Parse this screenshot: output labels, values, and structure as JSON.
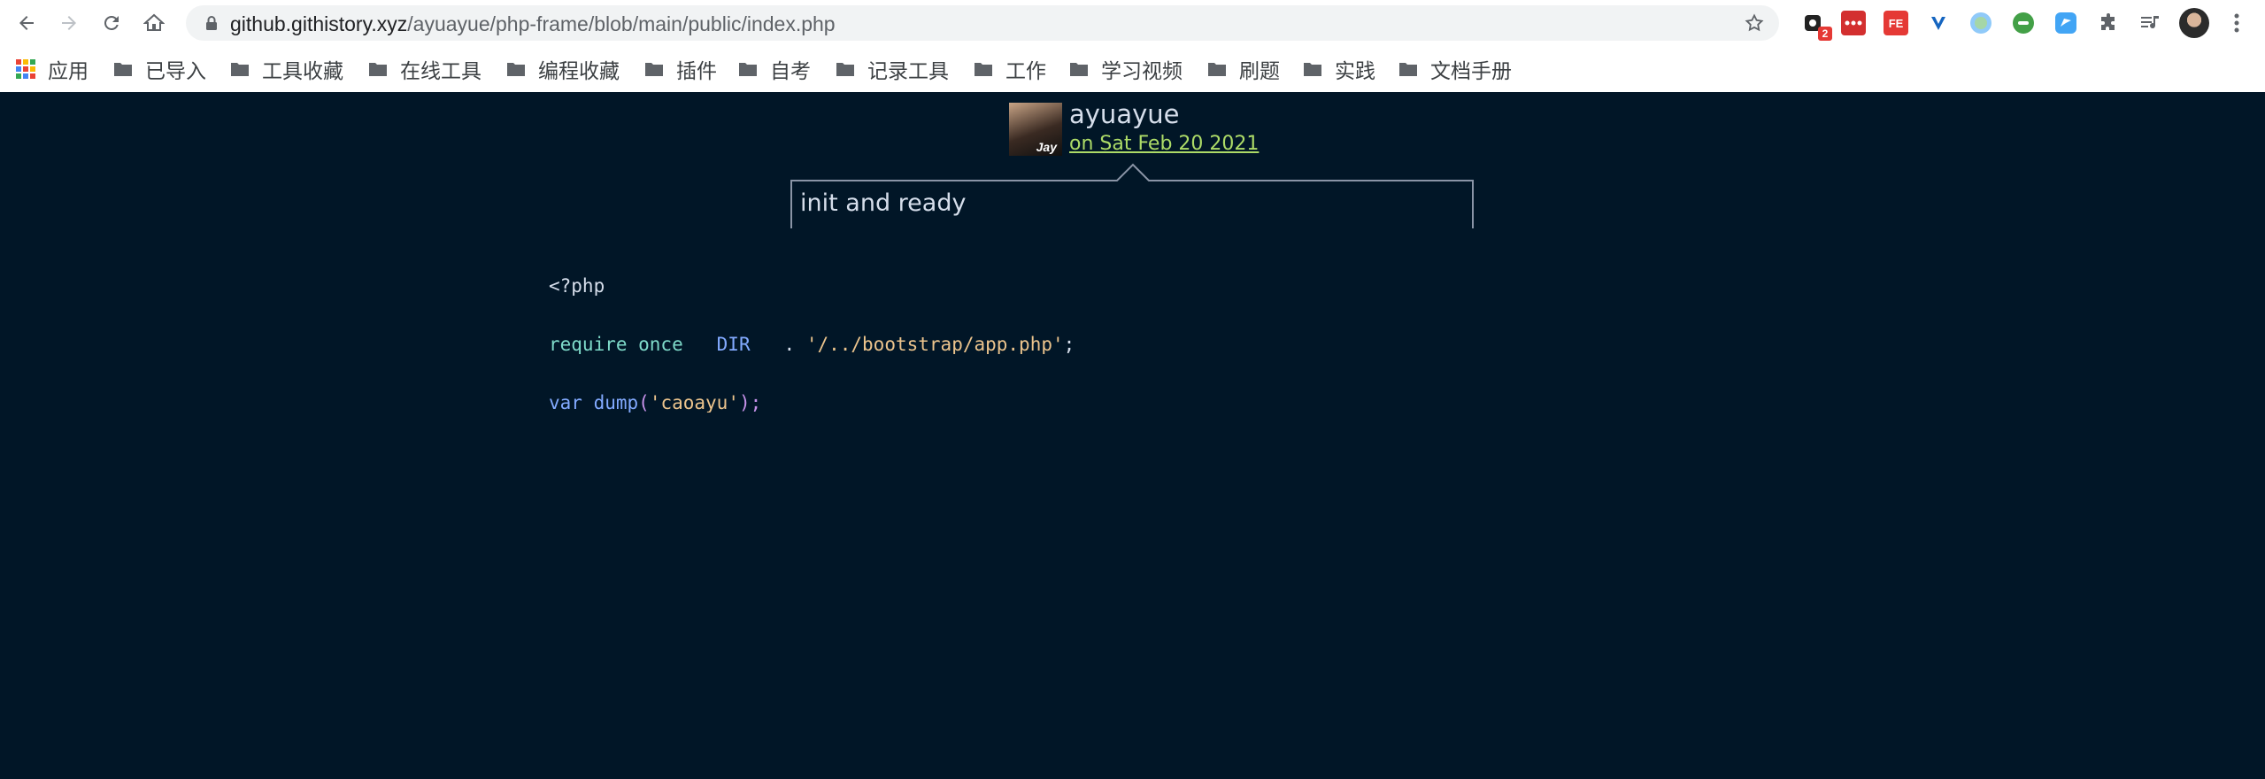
{
  "browser": {
    "url_host": "github.githistory.xyz",
    "url_path": "/ayuayue/php-frame/blob/main/public/index.php",
    "extension_badge": "2",
    "extension_fe_label": "FE"
  },
  "bookmarks": [
    {
      "label": "应用"
    },
    {
      "label": "已导入"
    },
    {
      "label": "工具收藏"
    },
    {
      "label": "在线工具"
    },
    {
      "label": "编程收藏"
    },
    {
      "label": "插件"
    },
    {
      "label": "自考"
    },
    {
      "label": "记录工具"
    },
    {
      "label": "工作"
    },
    {
      "label": "学习视频"
    },
    {
      "label": "刷题"
    },
    {
      "label": "实践"
    },
    {
      "label": "文档手册"
    }
  ],
  "commit": {
    "avatar_text": "Jay",
    "author": "ayuayue",
    "date": "on Sat Feb 20 2021",
    "message": "init and ready"
  },
  "code": {
    "line1": "<?php",
    "line2_fn": "require_once",
    "line2_const": "__DIR__",
    "line2_op": " . ",
    "line2_str": "'/../bootstrap/app.php'",
    "line2_end": ";",
    "line3_fn": "var_dump",
    "line3_open": "(",
    "line3_str": "'caoayu'",
    "line3_close": ");"
  }
}
